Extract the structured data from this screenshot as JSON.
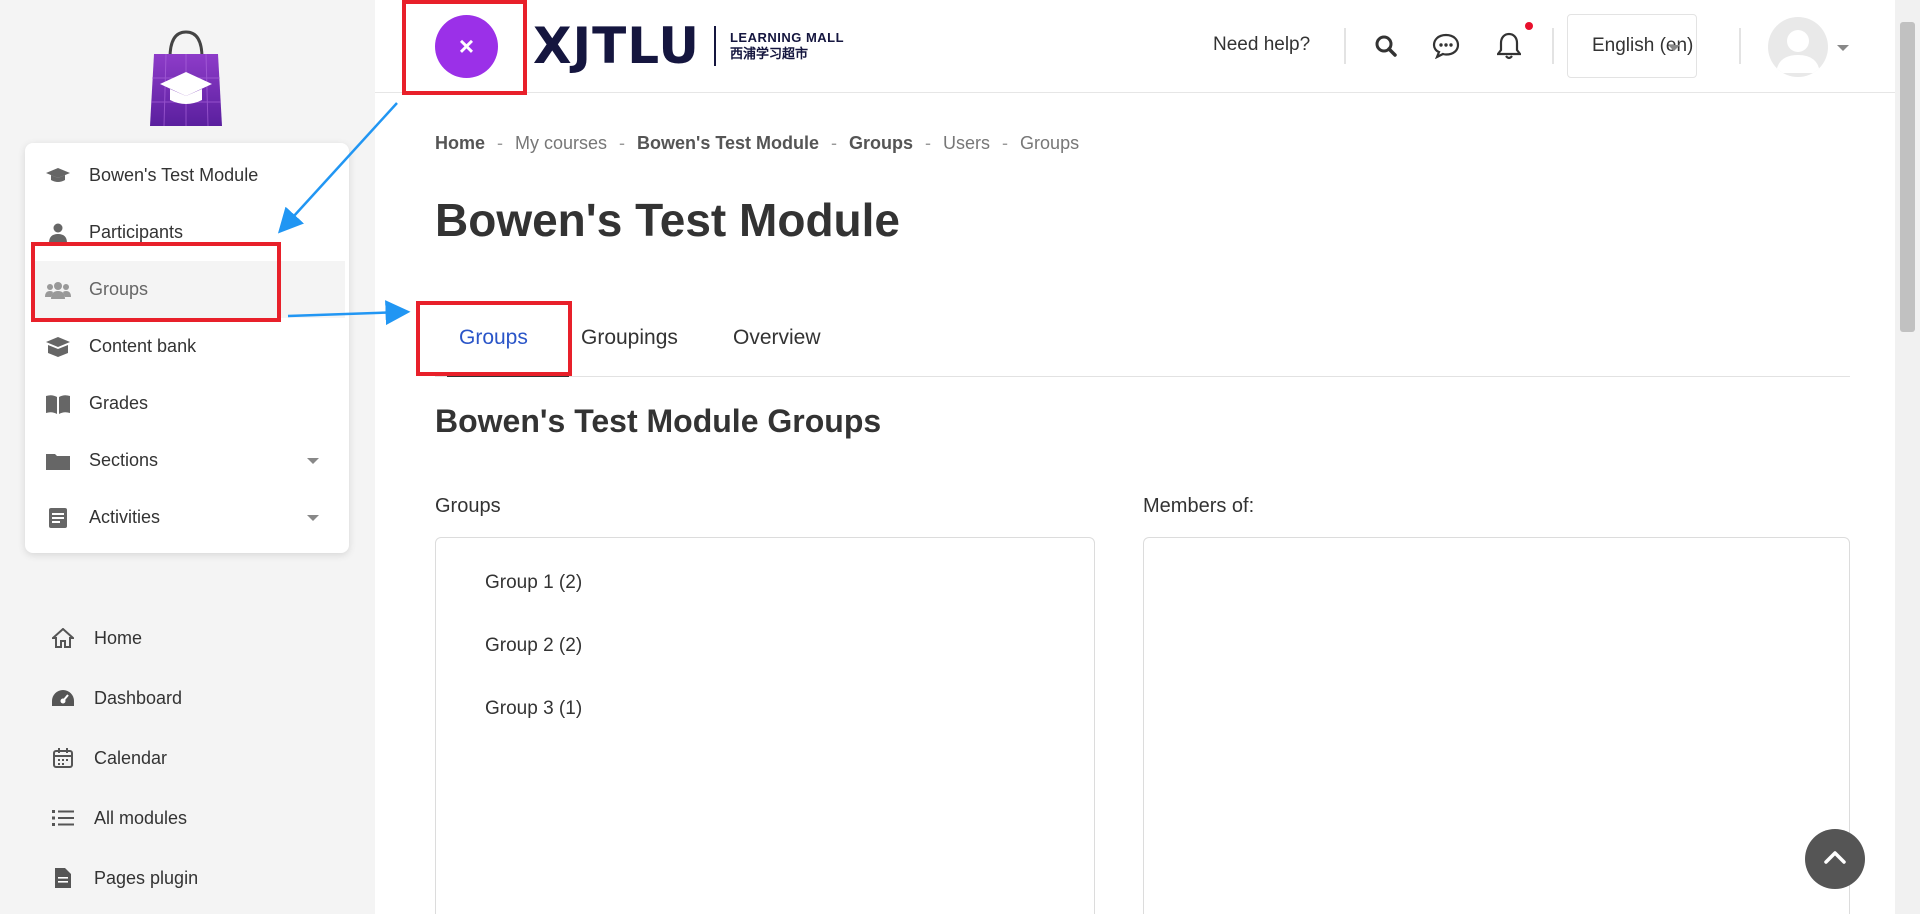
{
  "drawer": {
    "logo_icon": "shopping-bag-graduation-cap-logo",
    "course_nav": [
      {
        "label": "Bowen's Test Module",
        "icon": "graduation-cap-icon"
      },
      {
        "label": "Participants",
        "icon": "user-icon"
      },
      {
        "label": "Groups",
        "icon": "users-icon",
        "active": true
      },
      {
        "label": "Content bank",
        "icon": "box-icon"
      },
      {
        "label": "Grades",
        "icon": "book-icon"
      },
      {
        "label": "Sections",
        "icon": "folder-icon",
        "has_caret": true
      },
      {
        "label": "Activities",
        "icon": "file-text-icon",
        "has_caret": true
      }
    ],
    "global_nav": [
      {
        "label": "Home",
        "icon": "home-icon"
      },
      {
        "label": "Dashboard",
        "icon": "tachometer-icon"
      },
      {
        "label": "Calendar",
        "icon": "calendar-icon"
      },
      {
        "label": "All modules",
        "icon": "list-icon"
      },
      {
        "label": "Pages plugin",
        "icon": "file-icon"
      }
    ]
  },
  "header": {
    "brand_main": "XJTLU",
    "brand_sub_line1": "LEARNING MALL",
    "brand_sub_line2": "西浦学习超市",
    "need_help": "Need help?",
    "language": "English (en)",
    "toggle_glyph": "×"
  },
  "breadcrumb": [
    {
      "label": "Home",
      "bold": true
    },
    {
      "label": "My courses",
      "bold": false
    },
    {
      "label": "Bowen's Test Module",
      "bold": true
    },
    {
      "label": "Groups",
      "bold": true
    },
    {
      "label": "Users",
      "bold": false
    },
    {
      "label": "Groups",
      "bold": false
    }
  ],
  "breadcrumb_sep": "-",
  "main": {
    "title": "Bowen's Test Module",
    "tabs": [
      {
        "label": "Groups",
        "active": true
      },
      {
        "label": "Groupings",
        "active": false
      },
      {
        "label": "Overview",
        "active": false
      }
    ],
    "section_title": "Bowen's Test Module Groups",
    "groups_label": "Groups",
    "members_label": "Members of:",
    "groups": [
      "Group 1 (2)",
      "Group 2 (2)",
      "Group 3 (1)"
    ]
  },
  "colors": {
    "accent_purple": "#9b30e8",
    "active_tab_blue": "#2a55c8",
    "annotation_red": "#e8202a",
    "annotation_arrow_blue": "#2196f3",
    "notification_dot": "#e8102c"
  }
}
